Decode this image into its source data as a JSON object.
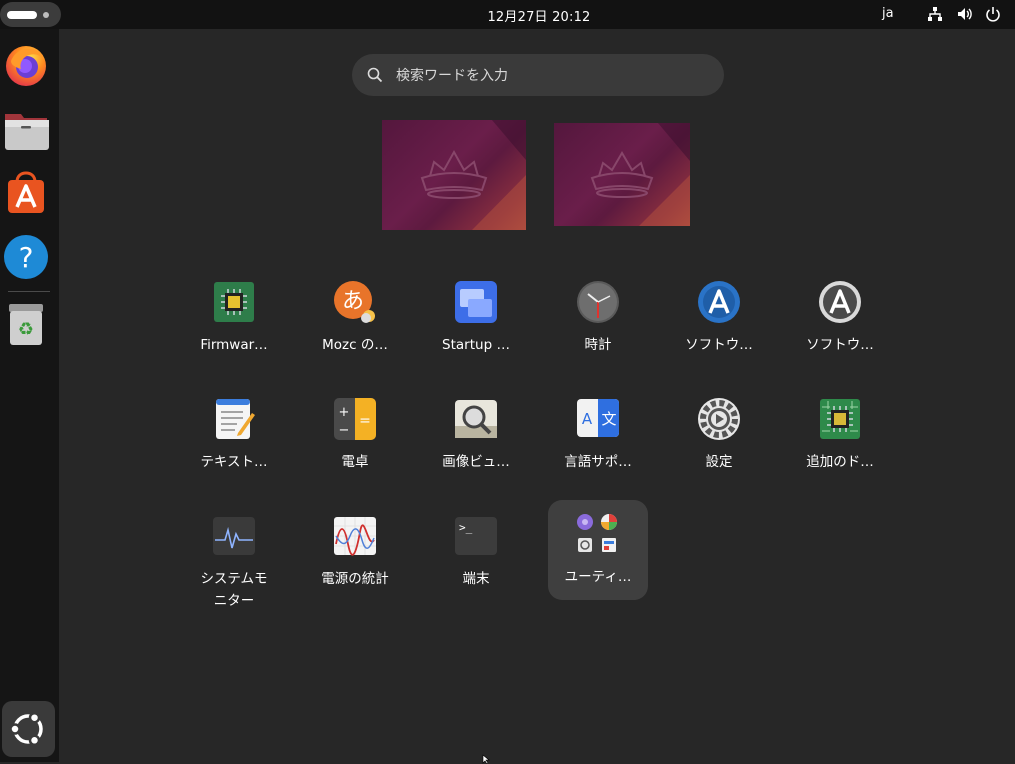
{
  "topbar": {
    "datetime": "12月27日  20:12",
    "language": "ja",
    "icons": [
      "network-icon",
      "volume-icon",
      "power-icon"
    ]
  },
  "dock": {
    "items": [
      {
        "name": "firefox",
        "icon": "firefox-icon"
      },
      {
        "name": "files",
        "icon": "files-icon"
      },
      {
        "name": "app-center",
        "icon": "app-center-icon"
      },
      {
        "name": "help",
        "icon": "help-icon"
      },
      {
        "name": "trash",
        "icon": "trash-icon"
      }
    ],
    "show_apps_icon": "ubuntu-logo-icon"
  },
  "search": {
    "placeholder": "検索ワードを入力"
  },
  "apps": [
    {
      "label": "Firmwar…",
      "icon": "firmware-icon"
    },
    {
      "label": "Mozc の…",
      "icon": "mozc-icon"
    },
    {
      "label": "Startup …",
      "icon": "startup-icon"
    },
    {
      "label": "時計",
      "icon": "clock-icon"
    },
    {
      "label": "ソフトウ…",
      "icon": "software-updater-icon"
    },
    {
      "label": "ソフトウ…",
      "icon": "software-properties-icon"
    },
    {
      "label": "テキスト…",
      "icon": "text-editor-icon"
    },
    {
      "label": "電卓",
      "icon": "calculator-icon"
    },
    {
      "label": "画像ビュ…",
      "icon": "image-viewer-icon"
    },
    {
      "label": "言語サポ…",
      "icon": "language-support-icon"
    },
    {
      "label": "設定",
      "icon": "settings-icon"
    },
    {
      "label": "追加のド…",
      "icon": "additional-drivers-icon"
    },
    {
      "label": "システムモ\nニター",
      "icon": "system-monitor-icon"
    },
    {
      "label": "電源の統計",
      "icon": "power-statistics-icon"
    },
    {
      "label": "端末",
      "icon": "terminal-icon"
    },
    {
      "label": "ユーティ…",
      "icon": "utilities-folder-icon"
    }
  ]
}
